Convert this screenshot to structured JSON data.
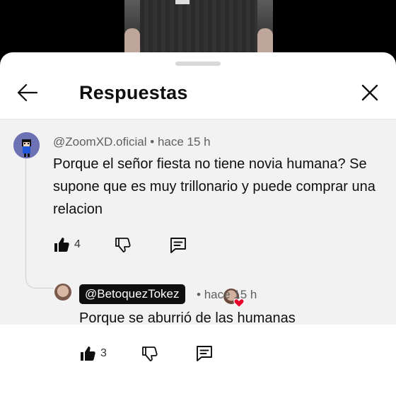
{
  "sheet": {
    "title": "Respuestas",
    "back_icon": "arrow-left-icon",
    "close_icon": "close-icon"
  },
  "parent_comment": {
    "handle": "@ZoomXD.oficial",
    "separator": "•",
    "time": "hace 15 h",
    "text": "Porque el señor fiesta no tiene novia humana? Se supone que es muy trillonario y puede comprar una relacion",
    "likes": "4",
    "creator_heart": true
  },
  "reply_comment": {
    "handle": "@BetoquezTokez",
    "separator": "•",
    "time": "hace 15 h",
    "text": "Porque se aburrió de las humanas",
    "likes": "3"
  },
  "colors": {
    "highlight_bg": "#f2f2f2",
    "text": "#0f0f0f",
    "meta": "#606060",
    "heart": "#e8002a"
  }
}
